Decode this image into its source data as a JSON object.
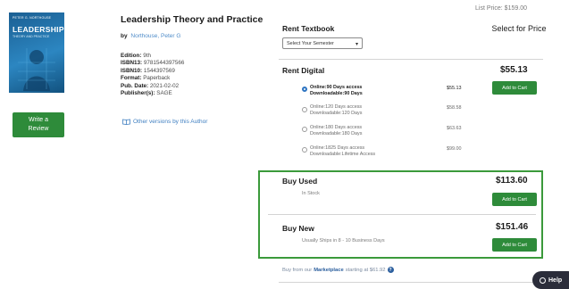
{
  "book": {
    "cover_author": "PETER G. NORTHOUSE",
    "cover_title": "LEADERSHIP",
    "cover_subtitle": "THEORY AND PRACTICE",
    "title": "Leadership Theory and Practice",
    "by_label": "by",
    "author": "Northouse, Peter G",
    "details": [
      {
        "label": "Edition:",
        "value": "9th"
      },
      {
        "label": "ISBN13:",
        "value": "9781544397566"
      },
      {
        "label": "ISBN10:",
        "value": "1544397569"
      },
      {
        "label": "Format:",
        "value": "Paperback"
      },
      {
        "label": "Pub. Date:",
        "value": "2021-02-02"
      },
      {
        "label": "Publisher(s):",
        "value": "SAGE"
      }
    ],
    "other_versions": "Other versions by this Author",
    "write_review": "Write a Review"
  },
  "pricing": {
    "list_price": "List Price: $159.00",
    "rent_textbook": "Rent Textbook",
    "select_for_price": "Select for Price",
    "semester_select": "Select Your Semester",
    "rent_digital": "Rent Digital",
    "rent_digital_price": "$55.13",
    "add_to_cart": "Add to Cart",
    "digital_options": [
      {
        "line1": "Online:90 Days access",
        "line2": "Downloadable:90 Days",
        "price": "$55.13",
        "selected": true
      },
      {
        "line1": "Online:120 Days access",
        "line2": "Downloadable:120 Days",
        "price": "$58.58",
        "selected": false
      },
      {
        "line1": "Online:180 Days access",
        "line2": "Downloadable:180 Days",
        "price": "$63.63",
        "selected": false
      },
      {
        "line1": "Online:1825 Days access",
        "line2": "Downloadable:Lifetime Access",
        "price": "$99.00",
        "selected": false
      }
    ],
    "buy_used": {
      "label": "Buy Used",
      "price": "$113.60",
      "status": "In Stock"
    },
    "buy_new": {
      "label": "Buy New",
      "price": "$151.46",
      "status": "Usually Ships in 8 - 10 Business Days"
    },
    "marketplace_prefix": "Buy from our",
    "marketplace_link": "Marketplace",
    "marketplace_suffix": "starting at $61.92"
  },
  "help": {
    "label": "Help"
  },
  "colors": {
    "accent_green": "#2e8b3a",
    "highlight_border": "#3b9a3b",
    "link_blue": "#3f7fc1"
  }
}
